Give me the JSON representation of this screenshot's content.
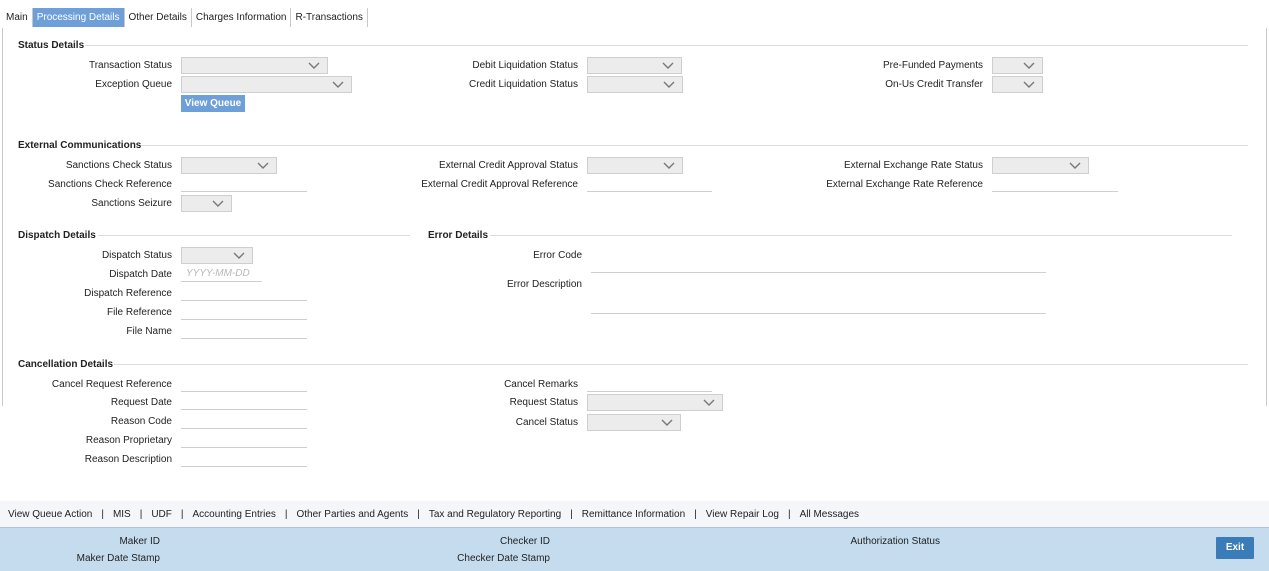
{
  "tabs": [
    "Main",
    "Processing Details",
    "Other Details",
    "Charges Information",
    "R-Transactions"
  ],
  "status_details": {
    "title": "Status Details",
    "transaction_status": "Transaction Status",
    "exception_queue": "Exception Queue",
    "view_queue": "View Queue",
    "debit_liquidation_status": "Debit Liquidation Status",
    "credit_liquidation_status": "Credit Liquidation Status",
    "pre_funded_payments": "Pre-Funded Payments",
    "on_us_credit_transfer": "On-Us Credit Transfer"
  },
  "external_communications": {
    "title": "External Communications",
    "sanctions_check_status": "Sanctions Check Status",
    "sanctions_check_reference": "Sanctions Check Reference",
    "sanctions_seizure": "Sanctions Seizure",
    "external_credit_approval_status": "External Credit Approval Status",
    "external_credit_approval_reference": "External Credit Approval Reference",
    "external_exchange_rate_status": "External Exchange Rate Status",
    "external_exchange_rate_reference": "External Exchange Rate Reference"
  },
  "dispatch_details": {
    "title": "Dispatch Details",
    "dispatch_status": "Dispatch Status",
    "dispatch_date": "Dispatch Date",
    "dispatch_date_placeholder": "YYYY-MM-DD",
    "dispatch_reference": "Dispatch Reference",
    "file_reference": "File Reference",
    "file_name": "File Name"
  },
  "error_details": {
    "title": "Error Details",
    "error_code": "Error Code",
    "error_description": "Error Description"
  },
  "cancellation_details": {
    "title": "Cancellation Details",
    "cancel_request_reference": "Cancel Request Reference",
    "request_date": "Request Date",
    "reason_code": "Reason Code",
    "reason_proprietary": "Reason Proprietary",
    "reason_description": "Reason Description",
    "cancel_remarks": "Cancel Remarks",
    "request_status": "Request Status",
    "cancel_status": "Cancel Status"
  },
  "links": [
    "View Queue Action",
    "MIS",
    "UDF",
    "Accounting Entries",
    "Other Parties and Agents",
    "Tax and Regulatory Reporting",
    "Remittance Information",
    "View Repair Log",
    "All Messages"
  ],
  "link_separator": "|",
  "footer": {
    "maker_id": "Maker ID",
    "maker_date_stamp": "Maker Date Stamp",
    "checker_id": "Checker ID",
    "checker_date_stamp": "Checker Date Stamp",
    "authorization_status": "Authorization Status",
    "exit": "Exit"
  },
  "colors": {
    "active_tab": "#6f9fd8",
    "footer_bg": "#c5dcee",
    "exit_button": "#3a7cb7",
    "select_bg": "#ececec"
  }
}
